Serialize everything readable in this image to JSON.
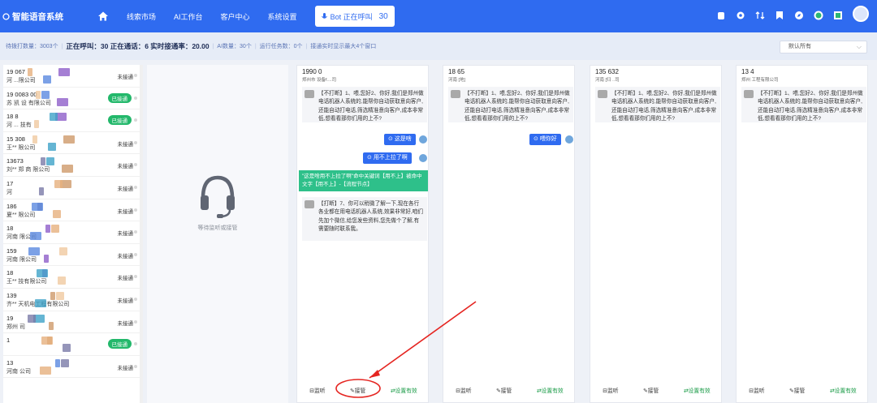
{
  "app": {
    "title": "智能语音系统",
    "logo_icon": "logo-icon"
  },
  "nav": {
    "items": [
      "线索市场",
      "AI工作台",
      "客户中心",
      "系统设置"
    ],
    "bot_status": "Bot 正在呼叫",
    "bot_count": "30",
    "icons": [
      "robot-icon",
      "settings-icon",
      "transfer-icon",
      "bookmark-icon",
      "compass-icon",
      "globe-icon",
      "screen-icon",
      "avatar"
    ]
  },
  "stats": {
    "pending": "待拨打数量：3003个",
    "calling": "正在呼叫：30 正在通话：6 实时接通率：20.00",
    "ai_count": "AI数量：30个",
    "tasks": "运行任务数：0个",
    "tip": "接通实时显示最大4个窗口",
    "filter_value": "默认所有"
  },
  "left_list": [
    {
      "l1": "19    067",
      "l2": "河          ...限公司",
      "status": "未接通",
      "done": false
    },
    {
      "l1": "19 0083 00",
      "l2": "苏    凯    设   有限公司",
      "status": "已接通",
      "done": true
    },
    {
      "l1": "18       8",
      "l2": "河 ...      技有",
      "status": "已接通",
      "done": true
    },
    {
      "l1": "15    308",
      "l2": "王**            限公司",
      "status": "未接通",
      "done": false
    },
    {
      "l1": "13673",
      "l2": "刘** 郑     商      限公司",
      "status": "未接通",
      "done": false
    },
    {
      "l1": "17",
      "l2": "河",
      "status": "未接通",
      "done": false
    },
    {
      "l1": "186",
      "l2": "夏**                 限公司",
      "status": "未接通",
      "done": false
    },
    {
      "l1": "18",
      "l2": "河南            限公司",
      "status": "未接通",
      "done": false
    },
    {
      "l1": "159",
      "l2": "河南                    限公司",
      "status": "未接通",
      "done": false
    },
    {
      "l1": "18",
      "l2": "王**           技有限公司",
      "status": "未接通",
      "done": false
    },
    {
      "l1": "139",
      "l2": "齐**         天机电工程有限公司",
      "status": "未接通",
      "done": false
    },
    {
      "l1": "19",
      "l2": "郑州             司",
      "status": "未接通",
      "done": false
    },
    {
      "l1": "1",
      "l2": "",
      "status": "已接通",
      "done": true
    },
    {
      "l1": "13",
      "l2": "河南            公司",
      "status": "未接通",
      "done": false
    }
  ],
  "monitor": {
    "text": "等待监听或接管",
    "icon": "headset-icon"
  },
  "panels": [
    {
      "phone": "1990   0",
      "sub": "郑州市       设备f....司",
      "msg": "【不打断】1、喂,您好2、你好,我们是郑州做电话机器人系统的,能帮你自动获取意向客户,还能自动打电话,筛选精准意向客户,成本非常低,想看看那你们用的上不?",
      "replies": [
        "这是啥",
        "用不上拉了啊"
      ],
      "note": "\"这是啥用不上拉了啊\"命中关键词【用不上】被命中文字【用不上】-【流程节点】",
      "msg2": "【打断】7、你可以稍微了解一下,现在各行各业都在用电话机器人系统,效果非常好,咱们先加个微信,给您发些资料,您先做个了解,有需要随时联系我。"
    },
    {
      "phone": "18      65",
      "sub": "河南     [地]",
      "msg": "【不打断】1、喂,您好2、你好,我们是郑州做电话机器人系统的,能帮你自动获取意向客户,还能自动打电话,筛选精准意向客户,成本非常低,想看看那你们用的上不?",
      "replies": [
        "喂你好"
      ]
    },
    {
      "phone": "135     632",
      "sub": "河南        [归    ..司",
      "msg": "【不打断】1、喂,您好2、你好,我们是郑州做电话机器人系统的,能帮你自动获取意向客户,还能自动打电话,筛选精准意向客户,成本非常低,想看看那你们用的上不?",
      "replies": []
    },
    {
      "phone": "13      4",
      "sub": "郑州         工程有限公司",
      "msg": "【不打断】1、喂,您好2、你好,我们是郑州做电话机器人系统的,能帮你自动获取意向客户,还能自动打电话,筛选精准意向客户,成本非常低,想看看那你们用的上不?",
      "replies": []
    }
  ],
  "footer": {
    "listen": "监听",
    "takeover": "接管",
    "valid": "设置有效"
  }
}
